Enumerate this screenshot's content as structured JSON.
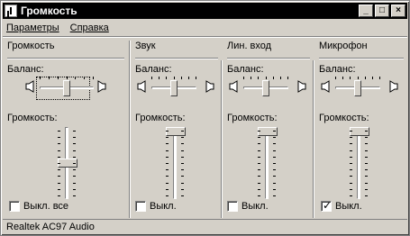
{
  "window": {
    "title": "Громкость"
  },
  "title_buttons": {
    "minimize": "_",
    "maximize": "□",
    "close": "×"
  },
  "menu": [
    {
      "label": "Параметры"
    },
    {
      "label": "Справка"
    }
  ],
  "columns": [
    {
      "name": "Громкость",
      "balance_label": "Баланс:",
      "volume_label": "Громкость:",
      "mute_label": "Выкл. все",
      "muted": false,
      "balance": 0.5,
      "volume": 0.5
    },
    {
      "name": "Звук",
      "balance_label": "Баланс:",
      "volume_label": "Громкость:",
      "mute_label": "Выкл.",
      "muted": false,
      "balance": 0.5,
      "volume": 1.0
    },
    {
      "name": "Лин. вход",
      "balance_label": "Баланс:",
      "volume_label": "Громкость:",
      "mute_label": "Выкл.",
      "muted": false,
      "balance": 0.5,
      "volume": 1.0
    },
    {
      "name": "Микрофон",
      "balance_label": "Баланс:",
      "volume_label": "Громкость:",
      "mute_label": "Выкл.",
      "muted": true,
      "balance": 0.5,
      "volume": 1.0
    }
  ],
  "status": {
    "text": "Realtek AC97 Audio"
  }
}
